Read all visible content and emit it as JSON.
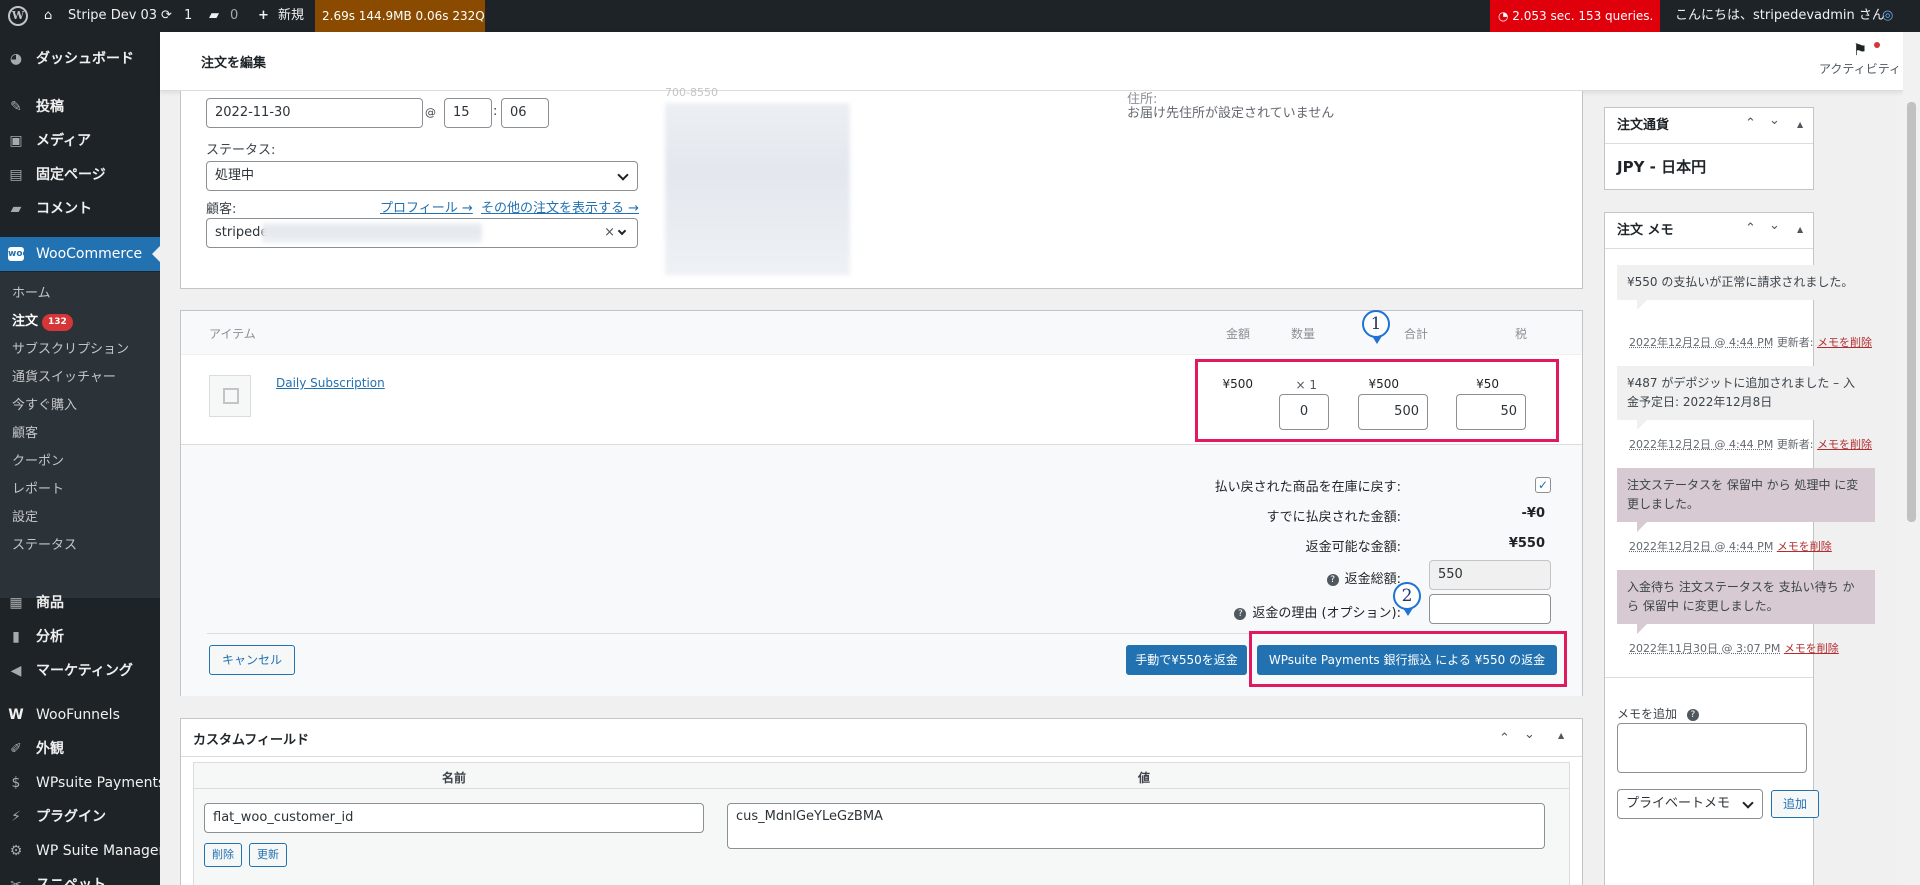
{
  "adminbar": {
    "site_name": "Stripe Dev 03",
    "updates_count": "1",
    "comments_count": "0",
    "new_label": "新規",
    "qm_stats": "2.69s  144.9MB  0.06s  232Q",
    "qm_alert": "2.053 sec. 153 queries.",
    "greeting": "こんにちは、stripedevadmin さん"
  },
  "sidebar": {
    "items": [
      {
        "label": "ダッシュボード",
        "icon": "gauge-icon"
      },
      {
        "label": "投稿",
        "icon": "pin-icon"
      },
      {
        "label": "メディア",
        "icon": "media-icon"
      },
      {
        "label": "固定ページ",
        "icon": "page-icon"
      },
      {
        "label": "コメント",
        "icon": "comment-icon"
      },
      {
        "label": "WooCommerce",
        "icon": "woo-icon"
      },
      {
        "label": "商品",
        "icon": "archive-icon"
      },
      {
        "label": "分析",
        "icon": "chart-icon"
      },
      {
        "label": "マーケティング",
        "icon": "megaphone-icon"
      },
      {
        "label": "WooFunnels",
        "icon": "funnel-icon"
      },
      {
        "label": "外観",
        "icon": "brush-icon"
      },
      {
        "label": "WPsuite Payments",
        "icon": "wallet-icon"
      },
      {
        "label": "プラグイン",
        "icon": "plugin-icon"
      },
      {
        "label": "WP Suite Manager",
        "icon": "gear-icon"
      },
      {
        "label": "スニペット",
        "icon": "scissors-icon"
      }
    ],
    "submenu": [
      "ホーム",
      "注文",
      "サブスクリプション",
      "通貨スイッチャー",
      "今すぐ購入",
      "顧客",
      "クーポン",
      "レポート",
      "設定",
      "ステータス"
    ],
    "orders_badge": "132"
  },
  "header": {
    "title": "注文を編集",
    "activity_label": "アクティビティ"
  },
  "order": {
    "date": "2022-11-30",
    "at": "@",
    "hour": "15",
    "colon": ":",
    "minute": "06",
    "status_label": "ステータス:",
    "status_value": "処理中",
    "customer_label": "顧客:",
    "profile_link": "プロフィール →",
    "other_orders_link": "その他の注文を表示する →",
    "customer_value": "stripede",
    "billing_fragment": "700-8550",
    "shipping_label": "住所:",
    "shipping_none": "お届け先住所が設定されていません"
  },
  "items": {
    "headers": {
      "item": "アイテム",
      "cost": "金額",
      "qty": "数量",
      "total": "合計",
      "tax": "税"
    },
    "product_name": "Daily Subscription",
    "cost": "¥500",
    "qty": "× 1",
    "total": "¥500",
    "tax": "¥50",
    "refund_qty": "0",
    "refund_total": "500",
    "refund_tax": "50"
  },
  "refund": {
    "restock_label": "払い戻された商品を在庫に戻す:",
    "already_label": "すでに払戻された金額:",
    "already_value": "-¥0",
    "available_label": "返金可能な金額:",
    "available_value": "¥550",
    "total_label": "返金総額:",
    "total_value": "550",
    "reason_label": "返金の理由 (オプション):",
    "cancel": "キャンセル",
    "manual": "手動で¥550を返金",
    "gateway": "WPsuite Payments 銀行振込 による ¥550 の返金"
  },
  "annotations": {
    "one": "1",
    "two": "2",
    "highlight_color": "#e1195e"
  },
  "custom_fields": {
    "title": "カスタムフィールド",
    "col_name": "名前",
    "col_value": "値",
    "row_key": "flat_woo_customer_id",
    "row_value": "cus_MdnlGeYLeGzBMA",
    "delete": "削除",
    "update": "更新"
  },
  "currency_box": {
    "title": "注文通貨",
    "value": "JPY - 日本円"
  },
  "notes_box": {
    "title": "注文 メモ",
    "notes": [
      {
        "text": "¥550 の支払いが正常に請求されました。",
        "date": "2022年12月2日 @ 4:44 PM",
        "by": "更新者:",
        "delete": "メモを削除"
      },
      {
        "text": "¥487 がデポジットに追加されました – 入金予定日: 2022年12月8日",
        "date": "2022年12月2日 @ 4:44 PM",
        "by": "更新者:",
        "delete": "メモを削除"
      },
      {
        "text": "注文ステータスを 保留中 から 処理中 に変更しました。",
        "date": "2022年12月2日 @ 4:44 PM",
        "by": "",
        "delete": "メモを削除"
      },
      {
        "text": "入金待ち 注文ステータスを 支払い待ち から 保留中 に変更しました。",
        "date": "2022年11月30日 @ 3:07 PM",
        "by": "",
        "delete": "メモを削除"
      }
    ],
    "add_label": "メモを追加",
    "type_value": "プライベートメモ",
    "add_button": "追加"
  }
}
